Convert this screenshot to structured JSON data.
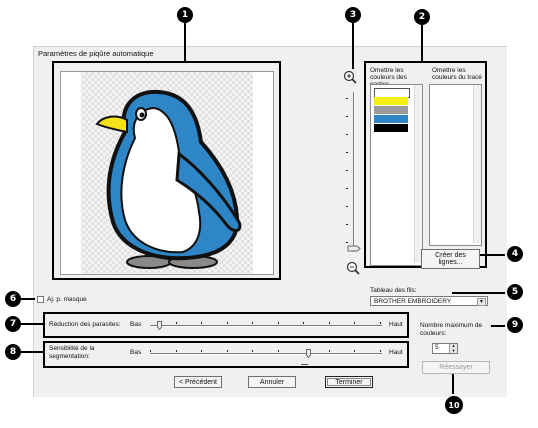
{
  "dialog": {
    "title": "Paramètres de piqûre automatique",
    "omit_parts_header": "Omettre les couleurs des parties",
    "omit_outline_header": "Omettre les couleurs du tracé",
    "create_lines_button": "Créer des lignes...",
    "thread_table_label": "Tableau des fils:",
    "thread_table_value": "BROTHER EMBROIDERY",
    "mask_checkbox_label": "Aj. p. masque",
    "noise_label": "Réduction des parasites:",
    "segmentation_label": "Sensibilité de la segmentation:",
    "low_label": "Bas",
    "high_label": "Haut",
    "max_colors_label": "Nombre maximum de couleurs:",
    "max_colors_value": "5",
    "retry_button": "Réessayer",
    "back_button": "< Précédent",
    "cancel_button": "Annuler",
    "finish_button": "Terminer",
    "noise_level_fraction": 0.04,
    "segmentation_level_fraction": 0.68,
    "mask_checked": false
  },
  "parts_colors": [
    "#ffffff",
    "#f5ee11",
    "#9a9a9a",
    "#2f86c4",
    "#000000"
  ],
  "callouts": [
    "1",
    "2",
    "3",
    "4",
    "5",
    "6",
    "7",
    "8",
    "9",
    "10"
  ],
  "icons": {
    "zoom_in": "zoom-in-icon",
    "zoom_out": "zoom-out-icon",
    "dropdown": "chevron-down-icon"
  }
}
